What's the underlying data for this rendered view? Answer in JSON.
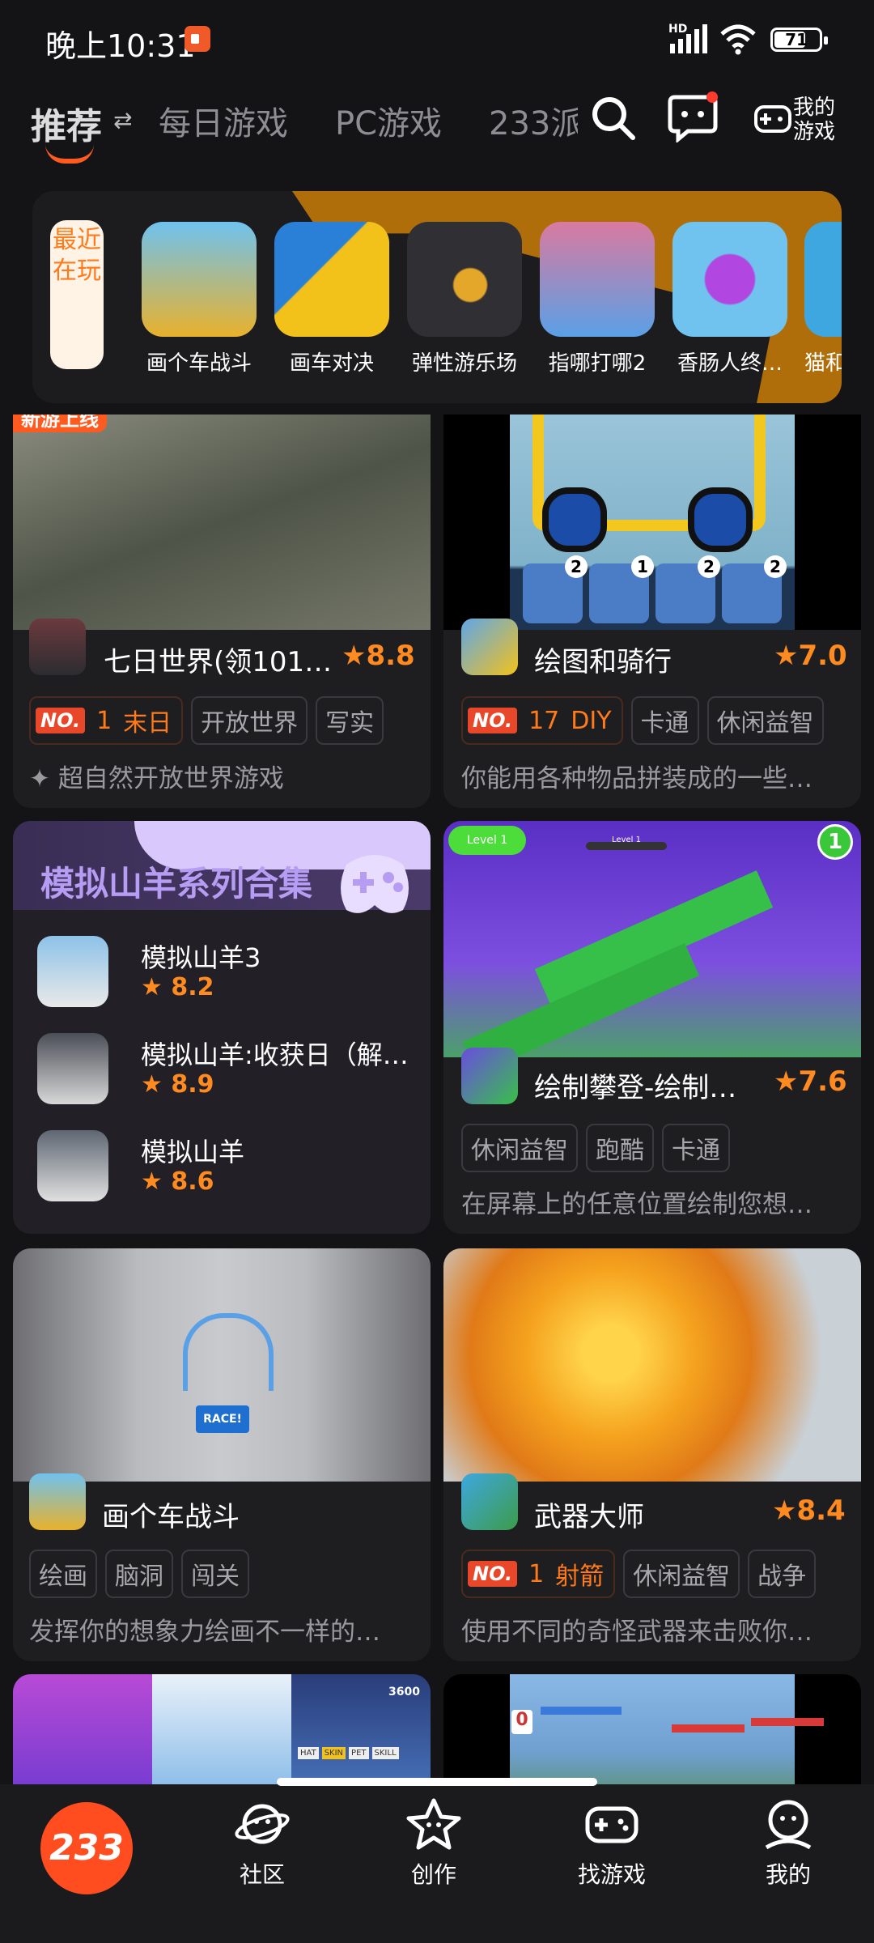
{
  "status": {
    "time": "晚上10:31",
    "network": "HD",
    "battery": "71",
    "battery_level": 0.71
  },
  "nav": {
    "tabs": [
      {
        "label": "推荐"
      },
      {
        "label": "每日游戏"
      },
      {
        "label": "PC游戏"
      },
      {
        "label": "233派"
      }
    ],
    "my_games": "我的\n游戏"
  },
  "recent": {
    "label": "最近在玩",
    "games": [
      {
        "name": "画个车战斗"
      },
      {
        "name": "画车对决"
      },
      {
        "name": "弹性游乐场"
      },
      {
        "name": "指哪打哪2"
      },
      {
        "name": "香肠人终…"
      },
      {
        "name": "猫和"
      }
    ]
  },
  "cards": {
    "c1": {
      "badge": "新游上线",
      "title": "七日世界(领101…",
      "score": "8.8",
      "rank_num": "1",
      "rank_cat": "末日",
      "tags": [
        "开放世界",
        "写实"
      ],
      "desc": "超自然开放世界游戏"
    },
    "c2": {
      "title": "绘图和骑行",
      "score": "7.0",
      "rank_num": "17",
      "rank_cat": "DIY",
      "tags": [
        "卡通",
        "休闲益智"
      ],
      "desc": "你能用各种物品拼装成的一些…",
      "counts": [
        "2",
        "1",
        "2",
        "2"
      ]
    },
    "c3": {
      "title": "模拟山羊系列合集",
      "items": [
        {
          "name": "模拟山羊3",
          "score": "8.2"
        },
        {
          "name": "模拟山羊:收获日（解…",
          "score": "8.9"
        },
        {
          "name": "模拟山羊",
          "score": "8.6"
        }
      ]
    },
    "c4": {
      "level_tag": "Level 1",
      "level_bar": "Level 1",
      "num": "1",
      "title": "绘制攀登-绘制…",
      "score": "7.6",
      "tags": [
        "休闲益智",
        "跑酷",
        "卡通"
      ],
      "desc": "在屏幕上的任意位置绘制您想…"
    },
    "c5": {
      "race": "RACE!",
      "title": "画个车战斗",
      "tags": [
        "绘画",
        "脑洞",
        "闯关"
      ],
      "desc": "发挥你的想象力绘画不一样的…"
    },
    "c6": {
      "title": "武器大师",
      "score": "8.4",
      "rank_num": "1",
      "rank_cat": "射箭",
      "tags": [
        "休闲益智",
        "战争"
      ],
      "desc": "使用不同的奇怪武器来击败你…"
    },
    "c7": {
      "score_chip": "3600",
      "skins": [
        "HAT",
        "SKIN",
        "PET",
        "SKILL"
      ]
    },
    "c8": {
      "counter": "0"
    }
  },
  "bottom": {
    "home": "233",
    "items": [
      {
        "label": "社区"
      },
      {
        "label": "创作"
      },
      {
        "label": "找游戏"
      },
      {
        "label": "我的"
      }
    ]
  },
  "colors": {
    "accent": "#ff5a1f",
    "score": "#ff8a1f",
    "purple": "#b69cf2",
    "background": "#141416"
  }
}
